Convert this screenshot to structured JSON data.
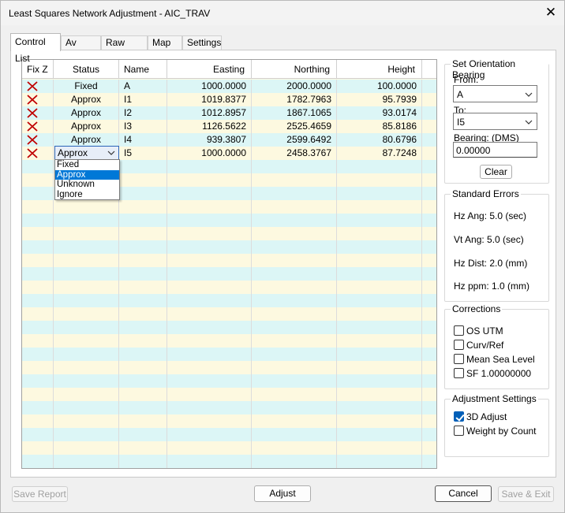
{
  "window": {
    "title": "Least Squares Network Adjustment - AIC_TRAV",
    "close_glyph": "✕"
  },
  "tabs": [
    {
      "label": "Control List",
      "active": true
    },
    {
      "label": "Av Data",
      "active": false
    },
    {
      "label": "Raw Data",
      "active": false
    },
    {
      "label": "Map",
      "active": false
    },
    {
      "label": "Settings",
      "active": false
    }
  ],
  "grid": {
    "columns": [
      "Fix Z",
      "Status",
      "Name",
      "Easting",
      "Northing",
      "Height"
    ],
    "rows": [
      {
        "fixz": "x-mark-icon",
        "status": "Fixed",
        "name": "A",
        "easting": "1000.0000",
        "northing": "2000.0000",
        "height": "100.0000"
      },
      {
        "fixz": "x-mark-icon",
        "status": "Approx",
        "name": "I1",
        "easting": "1019.8377",
        "northing": "1782.7963",
        "height": "95.7939"
      },
      {
        "fixz": "x-mark-icon",
        "status": "Approx",
        "name": "I2",
        "easting": "1012.8957",
        "northing": "1867.1065",
        "height": "93.0174"
      },
      {
        "fixz": "x-mark-icon",
        "status": "Approx",
        "name": "I3",
        "easting": "1126.5622",
        "northing": "2525.4659",
        "height": "85.8186"
      },
      {
        "fixz": "x-mark-icon",
        "status": "Approx",
        "name": "I4",
        "easting": "939.3807",
        "northing": "2599.6492",
        "height": "80.6796"
      },
      {
        "fixz": "x-mark-icon",
        "status": "Approx",
        "name": "I5",
        "easting": "1000.0000",
        "northing": "2458.3767",
        "height": "87.7248"
      }
    ],
    "status_dropdown": {
      "value": "Approx",
      "options": [
        "Fixed",
        "Approx",
        "Unknown",
        "Ignore"
      ],
      "selected": "Approx"
    },
    "colors": {
      "row_cyan": "#dcf6f6",
      "row_cream": "#fdf9e0",
      "x_mark": "#c00000"
    }
  },
  "orientation": {
    "title": "Set Orientation Bearing",
    "from_label": "From:",
    "from_value": "A",
    "to_label": "To:",
    "to_value": "I5",
    "bearing_label": "Bearing: (DMS)",
    "bearing_value": "0.00000",
    "clear_label": "Clear"
  },
  "standard_errors": {
    "title": "Standard Errors",
    "hz_ang": "Hz Ang: 5.0 (sec)",
    "vt_ang": "Vt Ang:  5.0 (sec)",
    "hz_dist": "Hz Dist: 2.0 (mm)",
    "hz_ppm": "Hz ppm: 1.0 (mm)"
  },
  "corrections": {
    "title": "Corrections",
    "items": [
      {
        "label": "OS UTM",
        "checked": false
      },
      {
        "label": "Curv/Ref",
        "checked": false
      },
      {
        "label": "Mean Sea Level",
        "checked": false
      },
      {
        "label": "SF 1.00000000",
        "checked": false
      }
    ]
  },
  "adjustment_settings": {
    "title": "Adjustment Settings",
    "items": [
      {
        "label": "3D Adjust",
        "checked": true
      },
      {
        "label": "Weight by Count",
        "checked": false
      }
    ]
  },
  "footer": {
    "save_report": "Save Report",
    "adjust": "Adjust",
    "cancel": "Cancel",
    "save_exit": "Save & Exit"
  },
  "accent": "#0078d7"
}
